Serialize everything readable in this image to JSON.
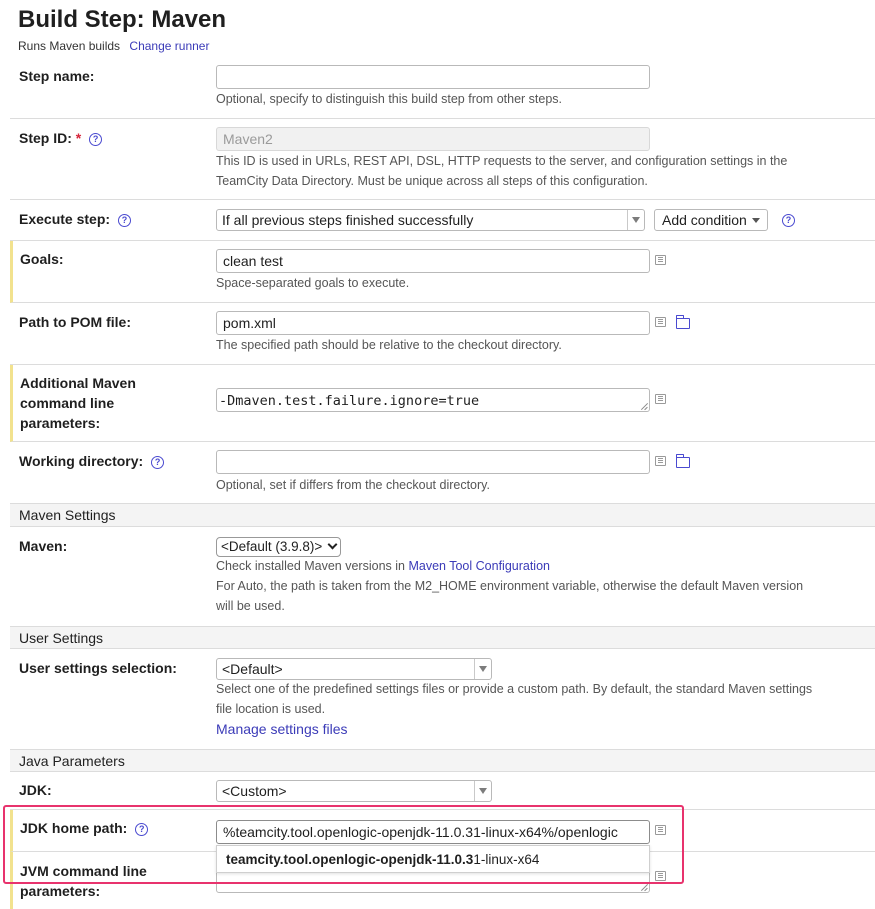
{
  "header": {
    "title": "Build Step: Maven",
    "subtitle": "Runs Maven builds",
    "change_runner": "Change runner"
  },
  "step_name": {
    "label": "Step name:",
    "value": "",
    "note": "Optional, specify to distinguish this build step from other steps."
  },
  "step_id": {
    "label": "Step ID:",
    "required_mark": "*",
    "value": "Maven2",
    "note_line1": "This ID is used in URLs, REST API, DSL, HTTP requests to the server, and configuration settings in the",
    "note_line2": "TeamCity Data Directory. Must be unique across all steps of this configuration."
  },
  "execute_step": {
    "label": "Execute step:",
    "value": "If all previous steps finished successfully",
    "add_condition": "Add condition"
  },
  "goals": {
    "label": "Goals:",
    "value": "clean test",
    "note": "Space-separated goals to execute."
  },
  "pom": {
    "label": "Path to POM file:",
    "value": "pom.xml",
    "note": "The specified path should be relative to the checkout directory."
  },
  "additional_params": {
    "label_line1": "Additional Maven",
    "label_line2": "command line",
    "label_line3": "parameters:",
    "value": "-Dmaven.test.failure.ignore=true"
  },
  "working_dir": {
    "label": "Working directory:",
    "value": "",
    "note": "Optional, set if differs from the checkout directory."
  },
  "maven_settings": {
    "section": "Maven Settings",
    "label": "Maven:",
    "value": "<Default (3.9.8)>",
    "note_prefix": "Check installed Maven versions in",
    "note_link": "Maven Tool Configuration",
    "note_line2": "For Auto, the path is taken from the M2_HOME environment variable, otherwise the default Maven version",
    "note_line3": "will be used."
  },
  "user_settings": {
    "section": "User Settings",
    "label": "User settings selection:",
    "value": "<Default>",
    "note_line1": "Select one of the predefined settings files or provide a custom path. By default, the standard Maven settings",
    "note_line2": "file location is used.",
    "manage_link": "Manage settings files"
  },
  "java": {
    "section": "Java Parameters",
    "jdk_label": "JDK:",
    "jdk_value": "<Custom>",
    "jdk_home_label": "JDK home path:",
    "jdk_home_value": "%teamcity.tool.openlogic-openjdk-11.0.31-linux-x64%/openlogic",
    "suggestion_bold": "teamcity.tool.openlogic-openjdk-11.0.3",
    "suggestion_rest": "1-linux-x64",
    "jvm_label_line1": "JVM command line",
    "jvm_label_line2": "parameters:"
  },
  "icons": {
    "help": "?",
    "list": "list-icon",
    "folder": "folder-icon"
  },
  "colors": {
    "link": "#3b3bb8",
    "required": "#d6243a",
    "highlight_border": "#f2e28e",
    "focus_frame": "#e8336d"
  }
}
